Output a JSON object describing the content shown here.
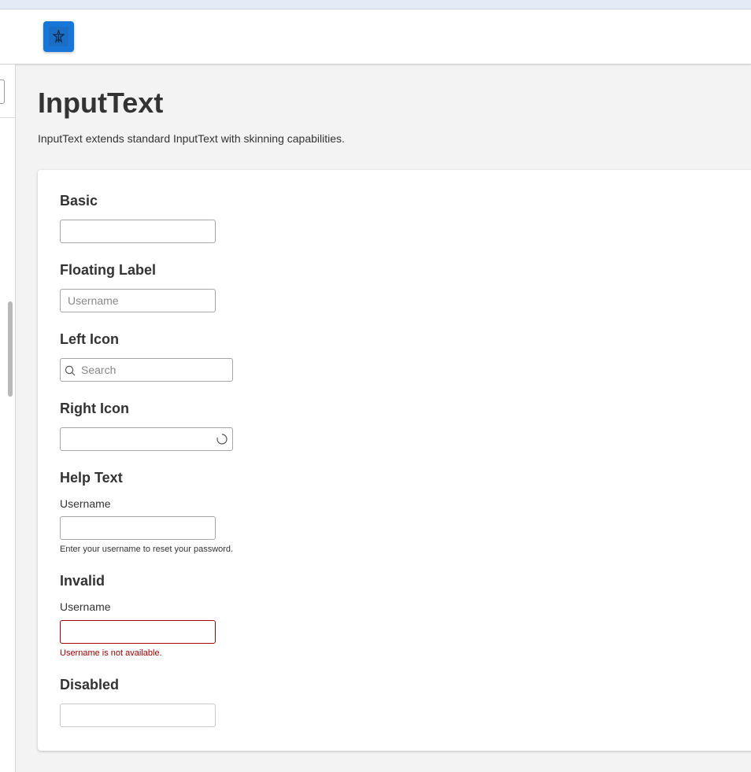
{
  "page": {
    "title": "InputText",
    "description": "InputText extends standard InputText with skinning capabilities."
  },
  "header": {
    "logo_icon": "app-logo-icon",
    "brand_color": "#1677d8"
  },
  "sections": {
    "basic": {
      "title": "Basic",
      "value": ""
    },
    "floating": {
      "title": "Floating Label",
      "placeholder": "Username"
    },
    "left_icon": {
      "title": "Left Icon",
      "placeholder": "Search",
      "icon": "search-icon"
    },
    "right_icon": {
      "title": "Right Icon",
      "icon": "spinner-icon"
    },
    "help_text": {
      "title": "Help Text",
      "label": "Username",
      "help": "Enter your username to reset your password."
    },
    "invalid": {
      "title": "Invalid",
      "label": "Username",
      "error": "Username is not available.",
      "error_color": "#a80000"
    },
    "disabled": {
      "title": "Disabled"
    }
  }
}
